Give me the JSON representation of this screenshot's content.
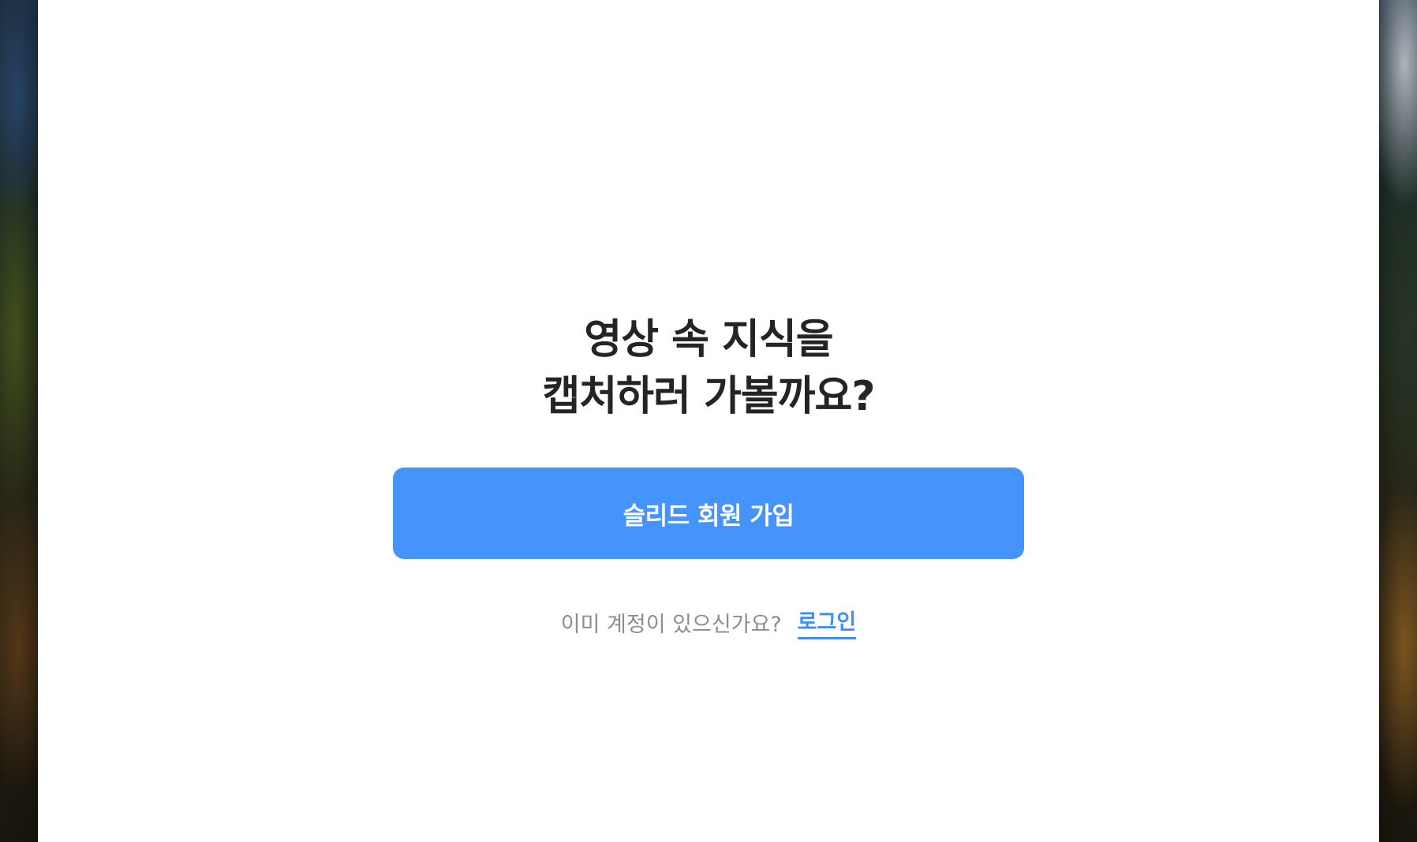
{
  "main": {
    "headline_line1": "영상 속 지식을",
    "headline_line2": "캡처하러 가볼까요?",
    "signup_button_label": "슬리드 회원 가입",
    "login_prompt": "이미 계정이 있으신가요?",
    "login_link_label": "로그인"
  },
  "colors": {
    "accent": "#4593fc",
    "link": "#3f8ef5",
    "heading": "#222427",
    "muted_text": "#8a8d92",
    "window_background": "#ffffff"
  }
}
